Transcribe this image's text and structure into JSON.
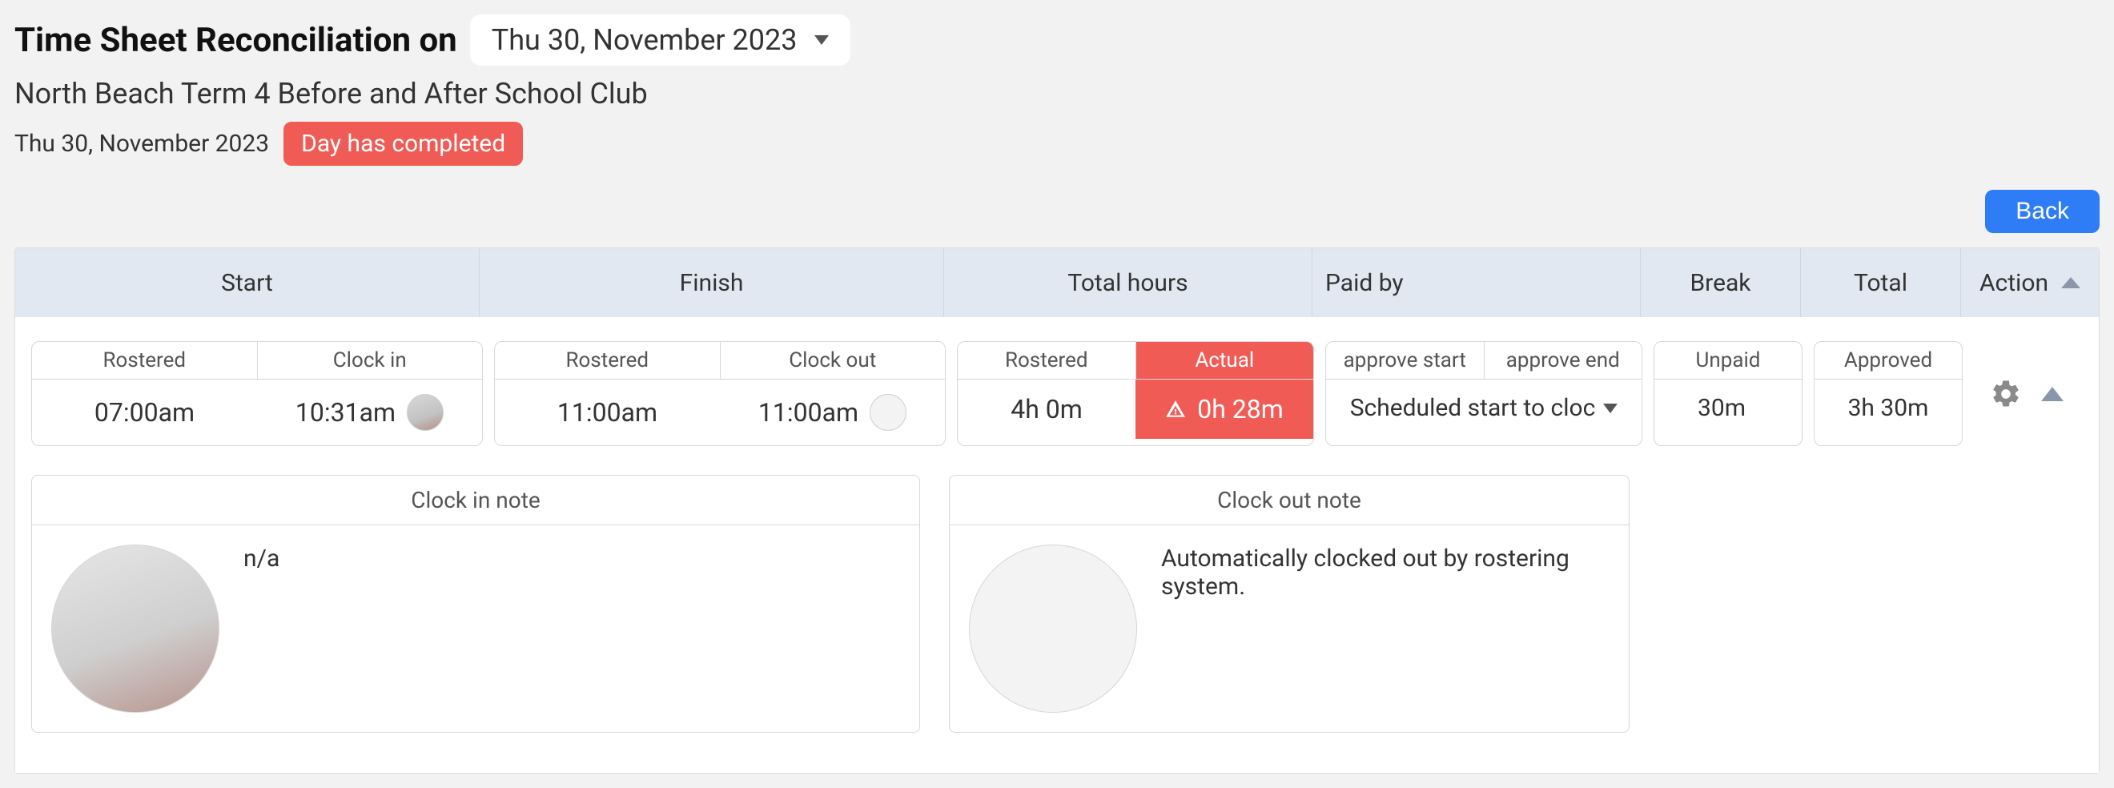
{
  "header": {
    "title_prefix": "Time Sheet Reconciliation on",
    "date_selected": "Thu 30, November 2023"
  },
  "subheader": "North Beach Term 4 Before and After School Club",
  "status_row": {
    "date_text": "Thu 30, November 2023",
    "day_status": "Day has completed"
  },
  "buttons": {
    "back": "Back"
  },
  "columns": {
    "start": "Start",
    "finish": "Finish",
    "total_hours": "Total hours",
    "paid_by": "Paid by",
    "break": "Break",
    "total": "Total",
    "action": "Action"
  },
  "row": {
    "start": {
      "rostered_label": "Rostered",
      "clockin_label": "Clock in",
      "rostered_value": "07:00am",
      "clockin_value": "10:31am"
    },
    "finish": {
      "rostered_label": "Rostered",
      "clockout_label": "Clock out",
      "rostered_value": "11:00am",
      "clockout_value": "11:00am"
    },
    "total_hours": {
      "rostered_label": "Rostered",
      "actual_label": "Actual",
      "rostered_value": "4h 0m",
      "actual_value": "0h 28m"
    },
    "paid_by": {
      "approve_start_label": "approve start",
      "approve_end_label": "approve end",
      "selection": "Scheduled start to cloc"
    },
    "break": {
      "label": "Unpaid",
      "value": "30m"
    },
    "total": {
      "label": "Approved",
      "value": "3h 30m"
    }
  },
  "notes": {
    "clock_in": {
      "heading": "Clock in note",
      "text": "n/a"
    },
    "clock_out": {
      "heading": "Clock out note",
      "text": "Automatically clocked out by rostering system."
    }
  }
}
